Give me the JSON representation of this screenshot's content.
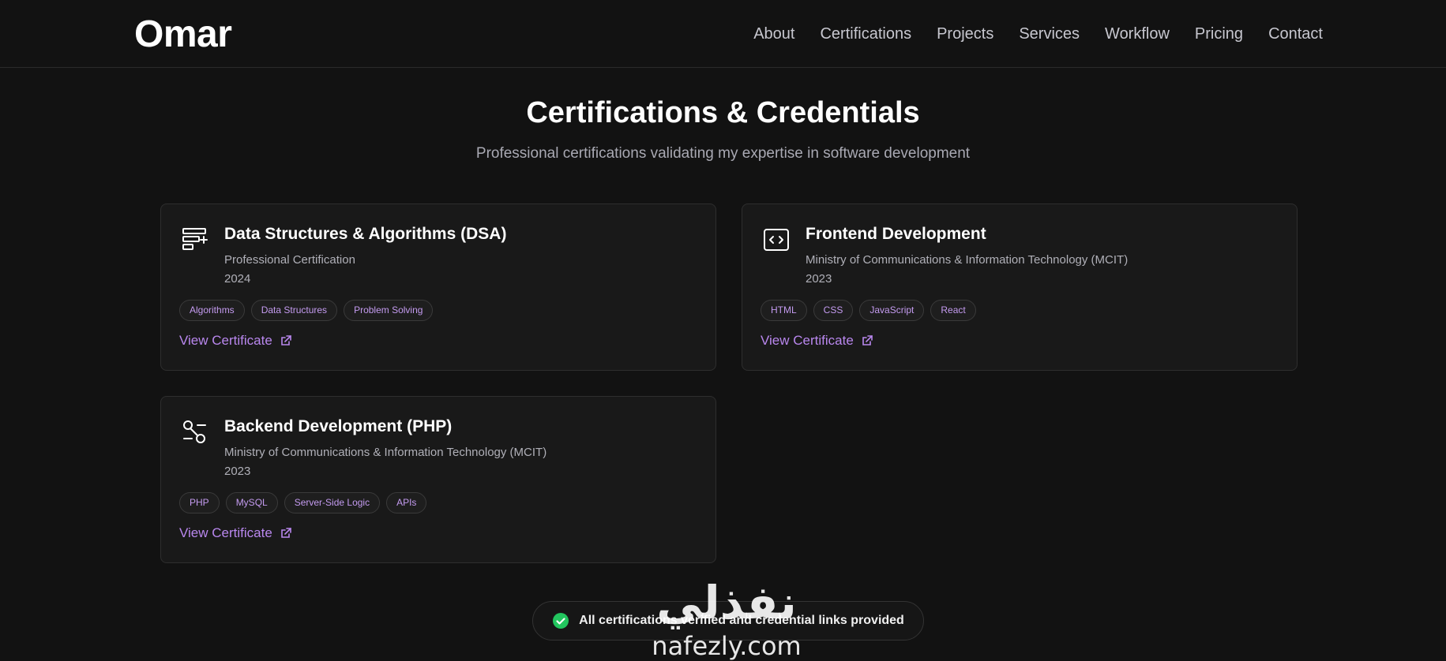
{
  "header": {
    "brand": "Omar",
    "nav": [
      "About",
      "Certifications",
      "Projects",
      "Services",
      "Workflow",
      "Pricing",
      "Contact"
    ]
  },
  "section": {
    "title": "Certifications & Credentials",
    "subtitle": "Professional certifications validating my expertise in software development"
  },
  "cards": [
    {
      "icon": "data-structure-icon",
      "title": "Data Structures & Algorithms (DSA)",
      "issuer": "Professional Certification",
      "year": "2024",
      "tags": [
        "Algorithms",
        "Data Structures",
        "Problem Solving"
      ],
      "link": "View Certificate"
    },
    {
      "icon": "code-window-icon",
      "title": "Frontend Development",
      "issuer": "Ministry of Communications & Information Technology (MCIT)",
      "year": "2023",
      "tags": [
        "HTML",
        "CSS",
        "JavaScript",
        "React"
      ],
      "link": "View Certificate"
    },
    {
      "icon": "workflow-icon",
      "title": "Backend Development (PHP)",
      "issuer": "Ministry of Communications & Information Technology (MCIT)",
      "year": "2023",
      "tags": [
        "PHP",
        "MySQL",
        "Server-Side Logic",
        "APIs"
      ],
      "link": "View Certificate"
    }
  ],
  "verification": {
    "text": "All certifications verified and credential links provided",
    "icon": "check-circle-icon",
    "color": "#22c55e"
  },
  "watermark": {
    "arabic": "نفذلي",
    "latin": "nafezly.com"
  },
  "colors": {
    "background": "#121212",
    "card": "#191919",
    "accent": "#b987ee",
    "tag_text": "#c49bf0"
  }
}
